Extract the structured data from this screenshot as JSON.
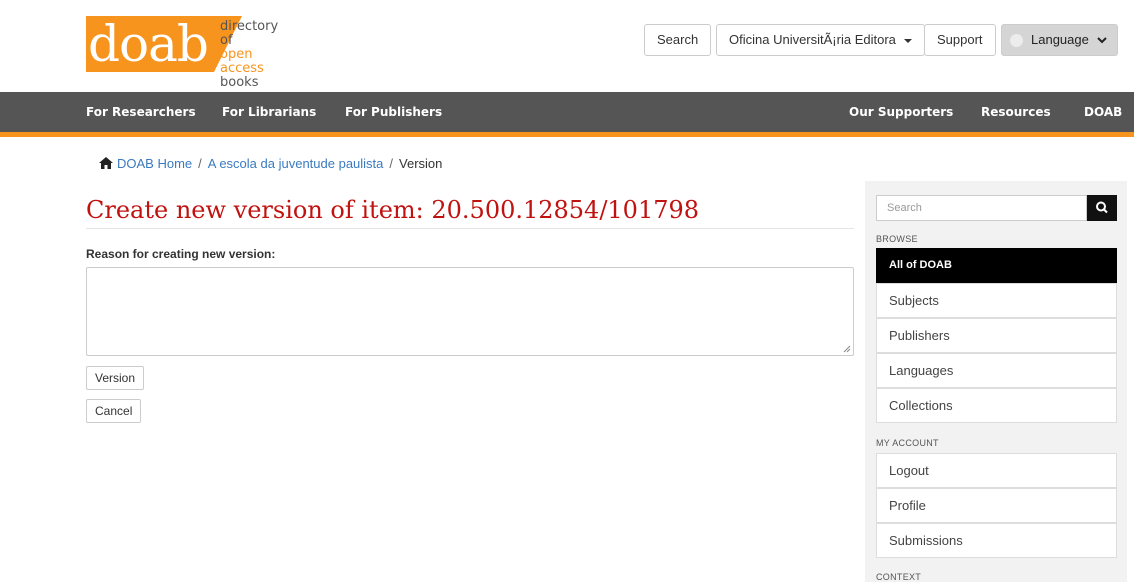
{
  "header": {
    "logo_word": "doab",
    "logo_tag_line1": "directory of",
    "logo_tag_line2": "open access",
    "logo_tag_line3": "books",
    "search_label": "Search",
    "publisher_label": "Oficina UniversitÃ¡ria Editora",
    "support_label": "Support",
    "language_label": "Language"
  },
  "nav": {
    "left": [
      "For Researchers",
      "For Librarians",
      "For Publishers"
    ],
    "right": [
      "Our Supporters",
      "Resources",
      "DOAB"
    ]
  },
  "breadcrumb": {
    "home": "DOAB Home",
    "item": "A escola da juventude paulista",
    "current": "Version",
    "sep": "/"
  },
  "main": {
    "title": "Create new version of item: 20.500.12854/101798",
    "reason_label": "Reason for creating new version:",
    "reason_value": "",
    "version_button": "Version",
    "cancel_button": "Cancel"
  },
  "sidebar": {
    "search_placeholder": "Search",
    "browse_heading": "BROWSE",
    "browse_items": [
      "All of DOAB",
      "Subjects",
      "Publishers",
      "Languages",
      "Collections"
    ],
    "account_heading": "MY ACCOUNT",
    "account_items": [
      "Logout",
      "Profile",
      "Submissions"
    ],
    "context_heading": "CONTEXT"
  },
  "colors": {
    "brand_orange": "#f7941d",
    "nav_bg": "#555555",
    "title_red": "#c0120f",
    "link_blue": "#3a7bbf"
  }
}
